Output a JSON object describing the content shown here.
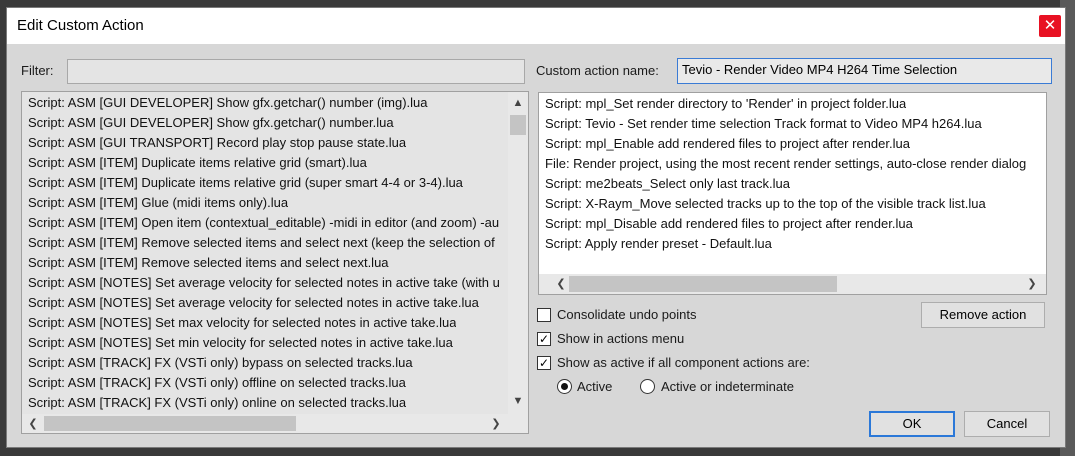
{
  "dialog": {
    "title": "Edit Custom Action",
    "close_glyph": "✕"
  },
  "filter": {
    "label": "Filter:",
    "value": ""
  },
  "custom_action_name": {
    "label": "Custom action name:",
    "value": "Tevio - Render Video MP4 H264 Time Selection"
  },
  "actions_list": [
    "Script: ASM [GUI DEVELOPER] Show gfx.getchar() number (img).lua",
    "Script: ASM [GUI DEVELOPER] Show gfx.getchar() number.lua",
    "Script: ASM [GUI TRANSPORT] Record play stop pause state.lua",
    "Script: ASM [ITEM] Duplicate items relative grid (smart).lua",
    "Script: ASM [ITEM] Duplicate items relative grid (super smart 4-4 or 3-4).lua",
    "Script: ASM [ITEM] Glue (midi items only).lua",
    "Script: ASM [ITEM] Open item (contextual_editable) -midi in editor (and zoom)  -au",
    "Script: ASM [ITEM] Remove selected items and select next (keep the selection of",
    "Script: ASM [ITEM] Remove selected items and select next.lua",
    "Script: ASM [NOTES] Set average velocity for selected notes in active take (with u",
    "Script: ASM [NOTES] Set average velocity for selected notes in active take.lua",
    "Script: ASM [NOTES] Set max velocity for selected notes in active take.lua",
    "Script: ASM [NOTES] Set min velocity for selected notes in active take.lua",
    "Script: ASM [TRACK] FX (VSTi only) bypass on selected tracks.lua",
    "Script: ASM [TRACK] FX (VSTi only) offline on selected tracks.lua",
    "Script: ASM [TRACK] FX (VSTi only) online on selected tracks.lua"
  ],
  "custom_action_list": [
    "Script: mpl_Set render directory to 'Render' in project folder.lua",
    "Script: Tevio - Set render time selection Track format to Video MP4 h264.lua",
    "Script: mpl_Enable add rendered files to project after render.lua",
    "File: Render project, using the most recent render settings, auto-close render dialog",
    "Script: me2beats_Select only last track.lua",
    "Script: X-Raym_Move selected tracks up to the top of the visible track list.lua",
    "Script: mpl_Disable add rendered files to project after render.lua",
    "Script: Apply render preset - Default.lua"
  ],
  "options": {
    "consolidate_undo": {
      "label": "Consolidate undo points",
      "checked": false
    },
    "show_in_menu": {
      "label": "Show in actions menu",
      "checked": true
    },
    "show_as_active": {
      "label": "Show as active if all component actions are:",
      "checked": true
    },
    "radio_active": {
      "label": "Active",
      "selected": true
    },
    "radio_indeterminate": {
      "label": "Active or indeterminate",
      "selected": false
    }
  },
  "buttons": {
    "remove_action": "Remove action",
    "ok": "OK",
    "cancel": "Cancel"
  },
  "glyphs": {
    "up": "▲",
    "down": "▼",
    "left": "❮",
    "right": "❯",
    "check": "✓"
  }
}
